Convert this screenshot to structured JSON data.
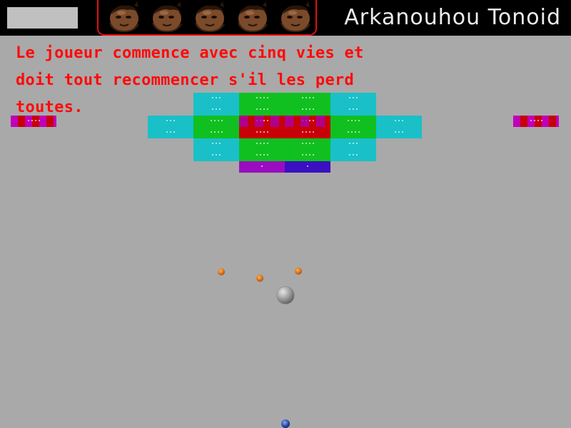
{
  "game": {
    "title": "Arkanouhou Tonoid",
    "message": "Le joueur commence avec cinq vies et doit tout recommencer s'il les perd toutes.",
    "lives": 5,
    "colors": {
      "background": "#a9a9a9",
      "topbar": "#000000",
      "score_box": "#c0c0c0",
      "lives_frame": "#e01010",
      "title": "#ececec",
      "message": "#ff0a0a"
    }
  },
  "bricks": {
    "colors": {
      "cyan": "#19c0c8",
      "green": "#10c020",
      "red": "#c80008",
      "purple": "#9a0cc0",
      "blue": "#3a10c0",
      "magenta": "#c000b8"
    },
    "rows": [
      {
        "row": 0,
        "cells": [
          [
            "cyan",
            4
          ],
          [
            "green",
            5
          ],
          [
            "green",
            6
          ],
          [
            "cyan",
            7
          ]
        ]
      },
      {
        "row": 1,
        "cells": [
          [
            "cyan",
            4
          ],
          [
            "green",
            5
          ],
          [
            "green",
            6
          ],
          [
            "cyan",
            7
          ]
        ]
      },
      {
        "row": 2,
        "cells": [
          [
            "cyan",
            3
          ],
          [
            "green",
            4
          ],
          [
            "red",
            5
          ],
          [
            "red",
            6
          ],
          [
            "green",
            7
          ],
          [
            "cyan",
            8
          ]
        ]
      },
      {
        "row": 3,
        "cells": [
          [
            "cyan",
            3
          ],
          [
            "green",
            4
          ],
          [
            "red",
            5
          ],
          [
            "red",
            6
          ],
          [
            "green",
            7
          ],
          [
            "cyan",
            8
          ]
        ]
      },
      {
        "row": 4,
        "cells": [
          [
            "cyan",
            4
          ],
          [
            "green",
            5
          ],
          [
            "green",
            6
          ],
          [
            "cyan",
            7
          ]
        ]
      },
      {
        "row": 5,
        "cells": [
          [
            "cyan",
            4
          ],
          [
            "green",
            5
          ],
          [
            "green",
            6
          ],
          [
            "cyan",
            7
          ]
        ]
      },
      {
        "row": 6,
        "cells": [
          [
            "purple",
            5
          ],
          [
            "blue",
            6
          ]
        ]
      }
    ],
    "side_bricks": [
      {
        "color": "magenta",
        "side": "left"
      },
      {
        "color": "magenta",
        "side": "right"
      }
    ]
  },
  "balls": {
    "main": {
      "name": "main-ball"
    },
    "small": [
      {
        "name": "small-ball"
      },
      {
        "name": "small-ball"
      },
      {
        "name": "small-ball"
      }
    ],
    "paddle": {
      "name": "paddle-ball"
    }
  }
}
